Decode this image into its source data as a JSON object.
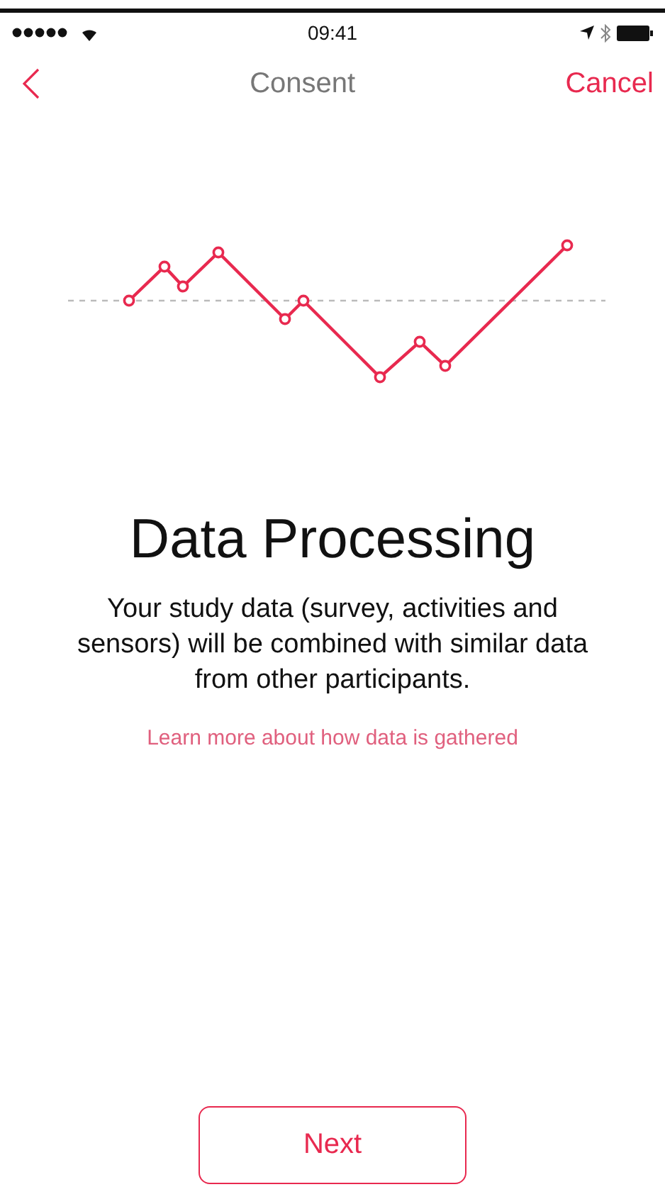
{
  "status_bar": {
    "time": "09:41"
  },
  "nav": {
    "title": "Consent",
    "cancel": "Cancel"
  },
  "step": {
    "title": "Data Processing",
    "body": "Your study data (survey, activities and sensors) will be combined with similar data from other participants.",
    "link": "Learn more about how data is gathered"
  },
  "button": "Next"
}
